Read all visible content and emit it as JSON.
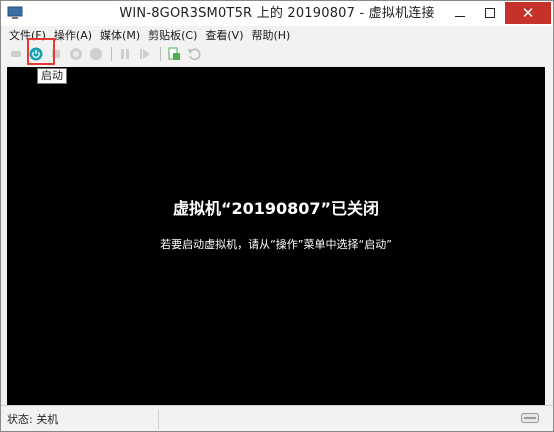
{
  "window": {
    "title": "WIN-8GOR3SM0T5R 上的 20190807 - 虚拟机连接",
    "close_label": "✕"
  },
  "menu": [
    "文件(F)",
    "操作(A)",
    "媒体(M)",
    "剪贴板(C)",
    "查看(V)",
    "帮助(H)"
  ],
  "toolbar": {
    "tooltip": "启动"
  },
  "screen": {
    "heading": "虚拟机“20190807”已关闭",
    "subtext": "若要启动虚拟机，请从“操作”菜单中选择“启动”"
  },
  "status": {
    "text": "状态: 关机"
  },
  "colors": {
    "accent": "#1a9fb3",
    "highlight": "#e53935",
    "close": "#c7312c"
  }
}
